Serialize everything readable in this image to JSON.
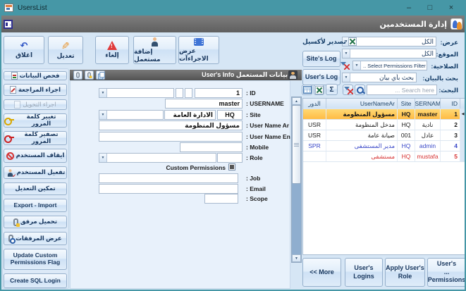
{
  "window": {
    "title": "UsersList"
  },
  "icons": {
    "minimize": "–",
    "maximize": "□",
    "close": "×",
    "undo": "↶",
    "pencil": "✎",
    "sigma": "Σ",
    "dropdown": "▼",
    "scroll_up": "▲",
    "scroll_down": "▼",
    "row_indicator": "◀",
    "check": "✔"
  },
  "header": {
    "title": "إدارة المستخدمين"
  },
  "toolbar": {
    "buttons": [
      {
        "label": "اغلاق"
      },
      {
        "label": "تعديل"
      },
      {
        "label": "إلغاء"
      },
      {
        "label": "إضافة مستعمل"
      },
      {
        "label": "عرض الاجراءآت"
      }
    ]
  },
  "sidebar": {
    "items": [
      {
        "label": "فحص البيانات"
      },
      {
        "label": "اجراء المراجعة"
      },
      {
        "label": "اجراء التخويل"
      },
      {
        "label": "تغيير كلمة المرور"
      },
      {
        "label": "تصفير كلمة المرور"
      },
      {
        "label": "ايقاف المستخدم"
      },
      {
        "label": "تفعيل المستخدم"
      },
      {
        "label": "تمكين التعديل"
      },
      {
        "label": "Export - Import"
      },
      {
        "label": "تحميل مرفق"
      },
      {
        "label": "عرض المرفقات"
      },
      {
        "label": "Update Custom Permissions Flag"
      },
      {
        "label": "Create SQL Login"
      }
    ]
  },
  "user_info": {
    "title": "بيانات المستعمل User's Info",
    "fields": {
      "id": {
        "label": ": ID",
        "value": "1"
      },
      "username": {
        "label": ": USERNAME",
        "value": "master"
      },
      "site": {
        "label": ": Site",
        "code": "HQ",
        "name": "الادارة العامة"
      },
      "name_ar": {
        "label": ": User Name Ar",
        "value": "مسؤول المنظومة"
      },
      "name_en": {
        "label": ": User Name En",
        "value": ""
      },
      "mobile": {
        "label": ": Mobile",
        "value": ""
      },
      "role": {
        "label": ": Role",
        "value": ""
      },
      "custom": {
        "label": "Custom Permissions"
      },
      "job": {
        "label": ": Job",
        "value": ""
      },
      "email": {
        "label": ": Email",
        "value": ""
      },
      "scope": {
        "label": ": Scope",
        "value": ""
      }
    }
  },
  "filters": {
    "view": {
      "label": "عرض:",
      "value": "الكل"
    },
    "site": {
      "label": "الموقع:",
      "value": "الكل"
    },
    "permission": {
      "label": "الصلاحية:",
      "value": ".. Select Permissions Filter"
    },
    "search_by": {
      "label": "بحث بالبيان:",
      "value": "بحث بأي بيان"
    },
    "search": {
      "label": "البحث:",
      "placeholder": "Search here ..."
    },
    "export_excel_label": "تصدير لأكسيل",
    "sites_log_label": "Site's Log",
    "users_log_label": "User's Log"
  },
  "grid": {
    "columns": {
      "role": "الدور",
      "name_ar": "UserNameAr",
      "site": "Site",
      "username": "USERNAME",
      "id": "ID"
    },
    "rows": [
      {
        "id": "1",
        "username": "master",
        "site": "HQ",
        "name_ar": "مسؤول المنظومة",
        "role": ""
      },
      {
        "id": "2",
        "username": "نادية",
        "site": "HQ",
        "name_ar": "مدخل المنظومة",
        "role": "USR"
      },
      {
        "id": "3",
        "username": "عادل",
        "site": "001",
        "name_ar": "صيانة عامة",
        "role": "USR"
      },
      {
        "id": "4",
        "username": "admin",
        "site": "HQ",
        "name_ar": "مدير المستشفى",
        "role": "SPR"
      },
      {
        "id": "5",
        "username": "mustafa",
        "site": "HQ",
        "name_ar": "مستشفى",
        "role": ""
      }
    ]
  },
  "footer": {
    "buttons": [
      {
        "label": "<< More"
      },
      {
        "label": "User's\nLogins"
      },
      {
        "label": "Apply User's\nRole"
      },
      {
        "label": "User's\n... Permissions"
      }
    ]
  }
}
